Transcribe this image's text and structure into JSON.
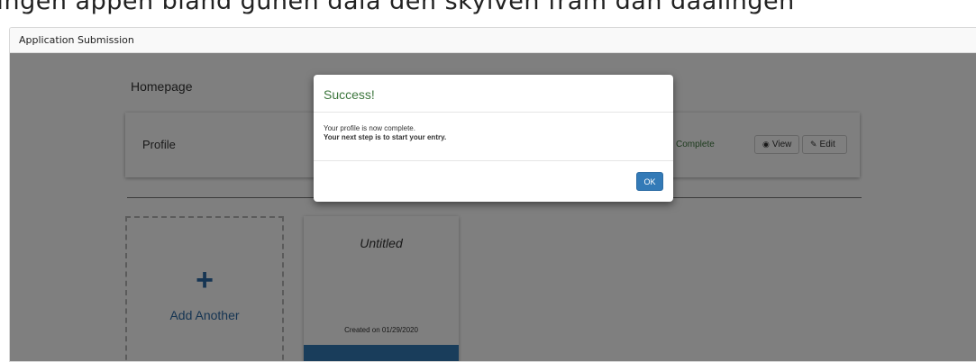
{
  "top_strip": {
    "text": "Ingen appen bland gunen dala den skylven fram dan daalingen"
  },
  "panel": {
    "title": "Application Submission"
  },
  "homepage": {
    "title": "Homepage",
    "profile": {
      "label": "Profile",
      "status": "Complete",
      "view_label": "View",
      "edit_label": "Edit"
    },
    "add_card": {
      "label": "Add Another"
    },
    "entry_card": {
      "title": "Untitled",
      "created": "Created on 01/29/2020"
    }
  },
  "modal": {
    "title": "Success!",
    "line1": "Your profile is now complete.",
    "line2": "Your next step is to start your entry.",
    "ok_label": "OK"
  },
  "colors": {
    "success_green": "#3c763d",
    "primary_blue": "#337ab7",
    "link_blue": "#2d6aa6"
  }
}
